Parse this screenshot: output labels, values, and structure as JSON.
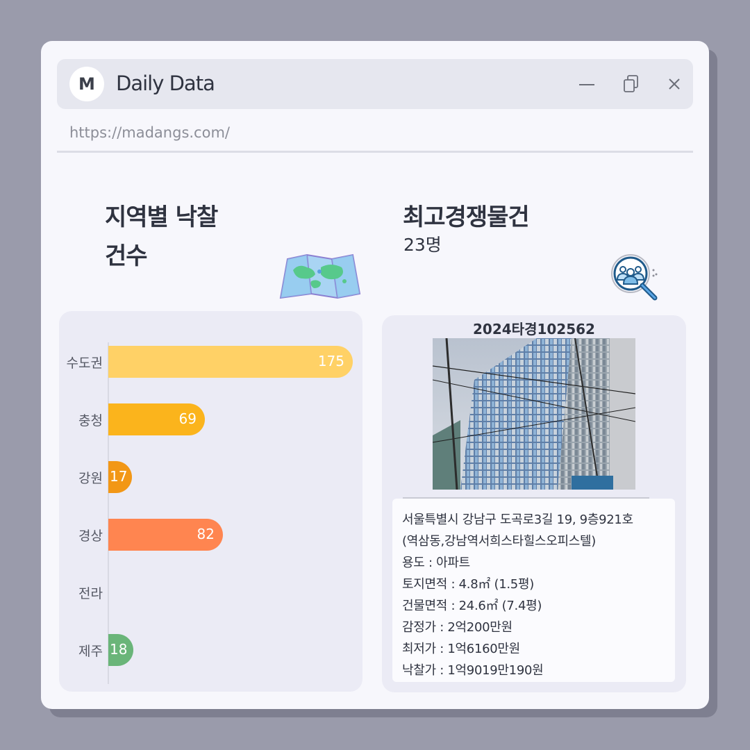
{
  "window": {
    "logo_letter": "M",
    "title": "Daily Data",
    "controls": {
      "minimize": "minimize-icon",
      "restore": "restore-icon",
      "close": "close-icon"
    }
  },
  "address": {
    "url": "https://madangs.com/"
  },
  "left_section": {
    "heading_line1": "지역별 낙찰",
    "heading_line2": "건수",
    "icon": "folded-map-icon"
  },
  "right_section": {
    "heading": "최고경쟁물건",
    "subheading": "23명",
    "icon": "people-search-icon"
  },
  "chart_data": {
    "type": "bar",
    "orientation": "horizontal",
    "categories": [
      "수도권",
      "충청",
      "강원",
      "경상",
      "전라",
      "제주"
    ],
    "values": [
      175,
      69,
      17,
      82,
      0,
      18
    ],
    "value_labels": [
      "175",
      "69",
      "17",
      "82",
      "",
      "18"
    ],
    "colors": [
      "#ffd166",
      "#fbb41c",
      "#f29716",
      "#ff8550",
      "#cccccc",
      "#6ab579"
    ],
    "xlim": [
      0,
      175
    ],
    "grid": false,
    "legend": "none"
  },
  "listing": {
    "case_number": "2024타경102562",
    "photo": "building-photo",
    "lines": [
      "서울특별시 강남구 도곡로3길 19, 9층921호",
      "(역삼동,강남역서희스타힐스오피스텔)",
      "용도 : 아파트",
      "토지면적 : 4.8㎡ (1.5평)",
      "건물면적 : 24.6㎡ (7.4평)",
      "감정가 : 2억200만원",
      "최저가 : 1억6160만원",
      "낙찰가 : 1억9019만190원"
    ]
  }
}
